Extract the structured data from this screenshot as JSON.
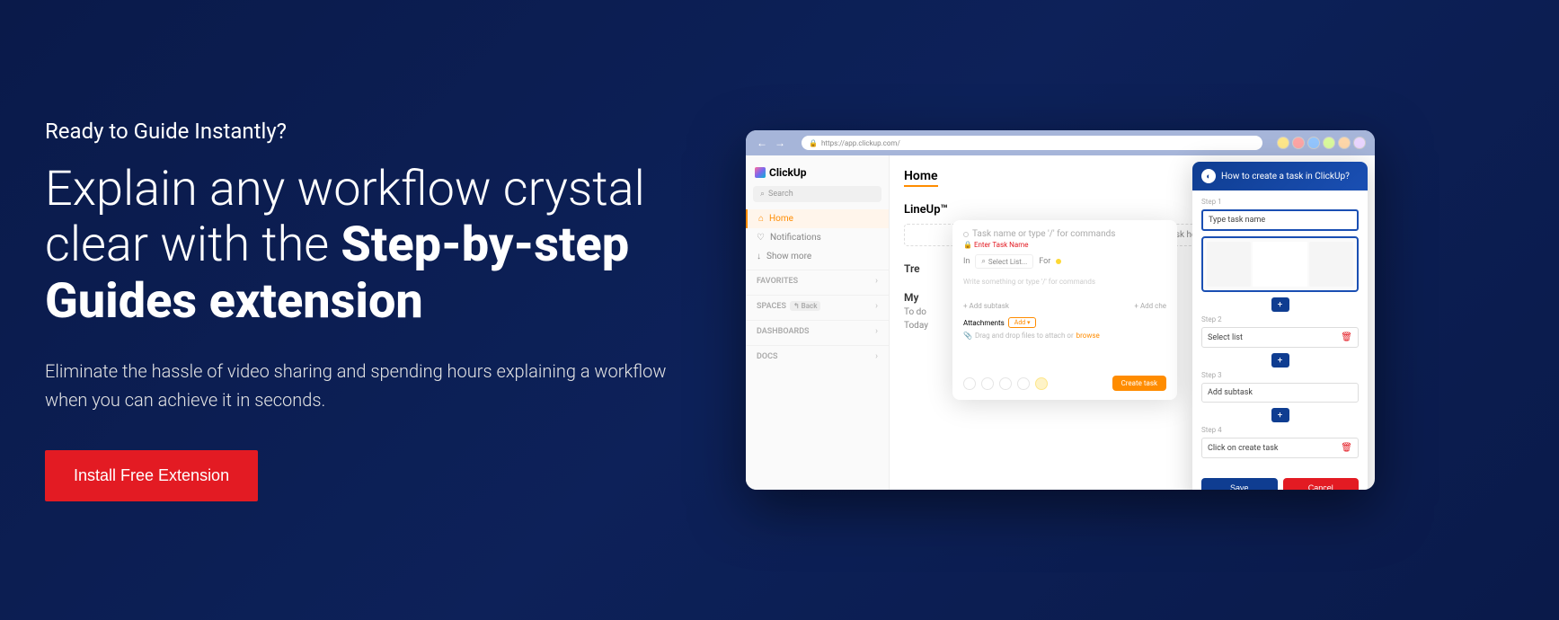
{
  "hero": {
    "eyebrow": "Ready to Guide Instantly?",
    "headline_light": "Explain any workflow crystal clear with the ",
    "headline_bold": "Step-by-step Guides extension",
    "subtext": "Eliminate the hassle of video sharing and spending hours explaining a workflow when you can achieve it in seconds.",
    "cta": "Install Free Extension"
  },
  "browser": {
    "url": "https://app.clickup.com/"
  },
  "app": {
    "brand": "ClickUp",
    "search_placeholder": "Search",
    "nav": {
      "home": "Home",
      "notifications": "Notifications",
      "show_more": "Show more"
    },
    "sections": {
      "favorites": "FAVORITES",
      "spaces": "SPACES",
      "spaces_back": "Back",
      "dashboards": "DASHBOARDS",
      "docs": "DOCS"
    },
    "main": {
      "title": "Home",
      "lineup": "LineUp™",
      "add_task": "+ Add your most important task here.",
      "trending": "Tre",
      "mywork": "My",
      "todo": "To do",
      "today": "Today"
    }
  },
  "task_modal": {
    "placeholder": "Task name or type '/' for commands",
    "error": "Enter Task Name",
    "in_label": "In",
    "select_list": "Select List...",
    "for_label": "For",
    "desc_placeholder": "Write something or type '/' for commands",
    "add_subtask": "Add subtask",
    "add_checklist": "Add che",
    "attachments": "Attachments",
    "add": "Add",
    "drag_text": "Drag and drop files to attach or",
    "browse": "browse",
    "create": "Create task"
  },
  "guide": {
    "title": "How to create a task in ClickUp?",
    "step1_label": "Step 1",
    "step1_text": "Type task name",
    "step2_label": "Step 2",
    "step2_text": "Select list",
    "step3_label": "Step 3",
    "step3_text": "Add subtask",
    "step4_label": "Step 4",
    "step4_text": "Click on create task",
    "save": "Save",
    "cancel": "Cancel"
  }
}
